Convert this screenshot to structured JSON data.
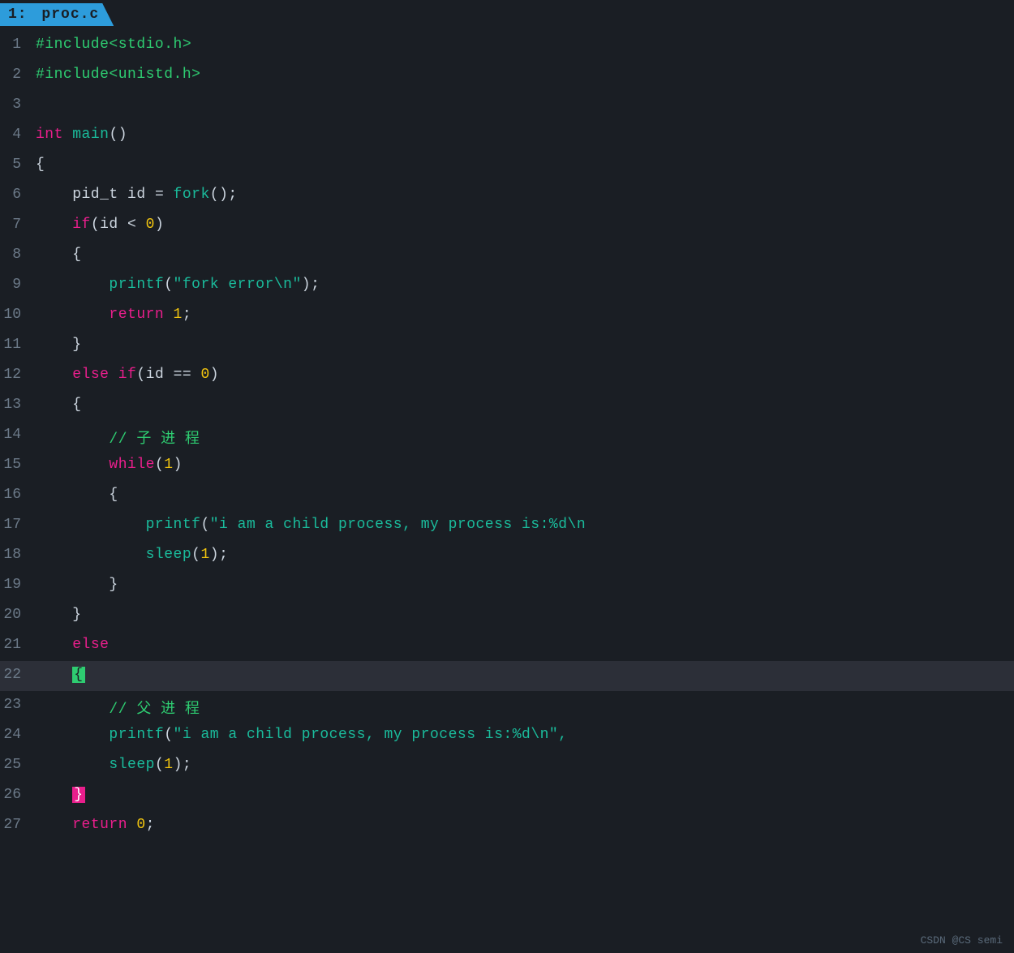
{
  "title": {
    "line_num": "1:",
    "filename": "proc.c"
  },
  "watermark": "CSDN @CS semi",
  "lines": [
    {
      "num": "1",
      "tokens": [
        {
          "t": "#include<stdio.h>",
          "c": "c-green"
        }
      ]
    },
    {
      "num": "2",
      "tokens": [
        {
          "t": "#include<unistd.h>",
          "c": "c-green"
        }
      ]
    },
    {
      "num": "3",
      "tokens": []
    },
    {
      "num": "4",
      "tokens": [
        {
          "t": "int",
          "c": "c-pink"
        },
        {
          "t": " ",
          "c": "c-white"
        },
        {
          "t": "main",
          "c": "c-cyan"
        },
        {
          "t": "()",
          "c": "c-white"
        }
      ]
    },
    {
      "num": "5",
      "tokens": [
        {
          "t": "{",
          "c": "c-white"
        }
      ]
    },
    {
      "num": "6",
      "tokens": [
        {
          "t": "    pid_t ",
          "c": "c-white"
        },
        {
          "t": "id",
          "c": "c-white"
        },
        {
          "t": " = ",
          "c": "c-white"
        },
        {
          "t": "fork",
          "c": "c-cyan"
        },
        {
          "t": "();",
          "c": "c-white"
        }
      ]
    },
    {
      "num": "7",
      "tokens": [
        {
          "t": "    ",
          "c": "c-white"
        },
        {
          "t": "if",
          "c": "c-pink"
        },
        {
          "t": "(id < ",
          "c": "c-white"
        },
        {
          "t": "0",
          "c": "c-yellow"
        },
        {
          "t": ")",
          "c": "c-white"
        }
      ]
    },
    {
      "num": "8",
      "tokens": [
        {
          "t": "    {",
          "c": "c-white"
        }
      ]
    },
    {
      "num": "9",
      "tokens": [
        {
          "t": "        ",
          "c": "c-white"
        },
        {
          "t": "printf",
          "c": "c-cyan"
        },
        {
          "t": "(",
          "c": "c-white"
        },
        {
          "t": "\"fork error\\n\"",
          "c": "c-cyan"
        },
        {
          "t": ");",
          "c": "c-white"
        }
      ]
    },
    {
      "num": "10",
      "tokens": [
        {
          "t": "        ",
          "c": "c-white"
        },
        {
          "t": "return",
          "c": "c-pink"
        },
        {
          "t": " ",
          "c": "c-white"
        },
        {
          "t": "1",
          "c": "c-yellow"
        },
        {
          "t": ";",
          "c": "c-white"
        }
      ]
    },
    {
      "num": "11",
      "tokens": [
        {
          "t": "    }",
          "c": "c-white"
        }
      ]
    },
    {
      "num": "12",
      "tokens": [
        {
          "t": "    ",
          "c": "c-white"
        },
        {
          "t": "else",
          "c": "c-pink"
        },
        {
          "t": " ",
          "c": "c-white"
        },
        {
          "t": "if",
          "c": "c-pink"
        },
        {
          "t": "(id == ",
          "c": "c-white"
        },
        {
          "t": "0",
          "c": "c-yellow"
        },
        {
          "t": ")",
          "c": "c-white"
        }
      ]
    },
    {
      "num": "13",
      "tokens": [
        {
          "t": "    {",
          "c": "c-white"
        }
      ]
    },
    {
      "num": "14",
      "tokens": [
        {
          "t": "        // ",
          "c": "c-comment"
        },
        {
          "t": "子 进 程",
          "c": "c-comment"
        }
      ]
    },
    {
      "num": "15",
      "tokens": [
        {
          "t": "        ",
          "c": "c-white"
        },
        {
          "t": "while",
          "c": "c-pink"
        },
        {
          "t": "(",
          "c": "c-white"
        },
        {
          "t": "1",
          "c": "c-yellow"
        },
        {
          "t": ")",
          "c": "c-white"
        }
      ]
    },
    {
      "num": "16",
      "tokens": [
        {
          "t": "        {",
          "c": "c-white"
        }
      ]
    },
    {
      "num": "17",
      "tokens": [
        {
          "t": "            ",
          "c": "c-white"
        },
        {
          "t": "printf",
          "c": "c-cyan"
        },
        {
          "t": "(",
          "c": "c-white"
        },
        {
          "t": "\"i am a child process, my process is:%d\\n",
          "c": "c-cyan"
        }
      ]
    },
    {
      "num": "18",
      "tokens": [
        {
          "t": "            ",
          "c": "c-white"
        },
        {
          "t": "sleep",
          "c": "c-cyan"
        },
        {
          "t": "(",
          "c": "c-white"
        },
        {
          "t": "1",
          "c": "c-yellow"
        },
        {
          "t": ");",
          "c": "c-white"
        }
      ]
    },
    {
      "num": "19",
      "tokens": [
        {
          "t": "        }",
          "c": "c-white"
        }
      ]
    },
    {
      "num": "20",
      "tokens": [
        {
          "t": "    }",
          "c": "c-white"
        }
      ]
    },
    {
      "num": "21",
      "tokens": [
        {
          "t": "    ",
          "c": "c-white"
        },
        {
          "t": "else",
          "c": "c-pink"
        }
      ]
    },
    {
      "num": "22",
      "tokens": [
        {
          "t": "    ",
          "c": "c-white"
        },
        {
          "t": "{",
          "c": "c-white",
          "highlight": true
        }
      ]
    },
    {
      "num": "23",
      "tokens": [
        {
          "t": "        // ",
          "c": "c-comment"
        },
        {
          "t": "父 进 程",
          "c": "c-comment"
        }
      ]
    },
    {
      "num": "24",
      "tokens": [
        {
          "t": "        ",
          "c": "c-white"
        },
        {
          "t": "printf",
          "c": "c-cyan"
        },
        {
          "t": "(",
          "c": "c-white"
        },
        {
          "t": "\"i am a child process, my process is:%d\\n\",",
          "c": "c-cyan"
        }
      ]
    },
    {
      "num": "25",
      "tokens": [
        {
          "t": "        ",
          "c": "c-white"
        },
        {
          "t": "sleep",
          "c": "c-cyan"
        },
        {
          "t": "(",
          "c": "c-white"
        },
        {
          "t": "1",
          "c": "c-yellow"
        },
        {
          "t": ");",
          "c": "c-white"
        }
      ]
    },
    {
      "num": "26",
      "tokens": [
        {
          "t": "    ",
          "c": "c-white"
        },
        {
          "t": "}",
          "c": "c-white",
          "highlight2": true
        }
      ]
    },
    {
      "num": "27",
      "tokens": [
        {
          "t": "    ",
          "c": "c-white"
        },
        {
          "t": "return",
          "c": "c-pink"
        },
        {
          "t": " ",
          "c": "c-white"
        },
        {
          "t": "0",
          "c": "c-yellow"
        },
        {
          "t": ";",
          "c": "c-white"
        }
      ]
    }
  ]
}
